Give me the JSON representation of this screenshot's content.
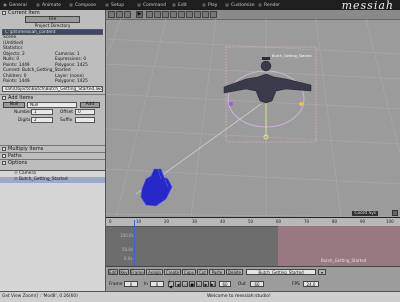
{
  "app": {
    "logo": "messiah"
  },
  "tabs": [
    {
      "label": "General"
    },
    {
      "label": "Animate"
    },
    {
      "label": "Compose"
    },
    {
      "label": "Setup"
    },
    {
      "label": "Command"
    },
    {
      "label": "Edit"
    },
    {
      "label": "Play"
    },
    {
      "label": "Customize"
    },
    {
      "label": "Render"
    }
  ],
  "left": {
    "current_item_header": "Current Item",
    "file_button": "File",
    "project_directory_label": "Project Directory",
    "project_directory_value": "C:\\pts\\messiah_content",
    "scene_label": "Scene",
    "scene_value": "(Untitled)",
    "statistics_label": "Statistics",
    "stats": [
      {
        "left": "Objects: 2",
        "right": "Cameras: 1"
      },
      {
        "left": "Nulls: 0",
        "right": "Expressions: 0"
      },
      {
        "left": "Points: 1449",
        "right": "Polygons: 1425"
      }
    ],
    "current_line": "Current: Butch_Getting_Started",
    "objects_line": "Children: 0",
    "layer_line": "Layer: (none)",
    "points_line2": "Points: 1449",
    "polygons_line2": "Polygons: 1425",
    "path_value": "sah\\Objects\\Butch\\Butch_Getting_Started.lwo",
    "add_items_label": "Add Items",
    "null_button": "Null",
    "null_field": "Null",
    "add_button": "Add",
    "number_label": "Number",
    "number_value": "1",
    "offset_label": "Offset",
    "offset_value": "0",
    "digits_label": "Digits",
    "digits_value": "2",
    "suffix_label": "Suffix",
    "multiply_items_label": "Multiply Items",
    "paths_label": "Paths",
    "options_label": "Options",
    "tree_items": [
      {
        "label": "Camera",
        "selected": false
      },
      {
        "label": "Butch_Getting_Started",
        "selected": true
      }
    ]
  },
  "viewport": {
    "coord_label": "Coord Sys",
    "item_label": "Butch_Getting_Started"
  },
  "timeline": {
    "ticks": [
      "0",
      "10",
      "20",
      "30",
      "40",
      "50",
      "60",
      "70",
      "80",
      "90",
      "100"
    ],
    "tracks": [
      "100.0s",
      "50.0s",
      "0.0s"
    ],
    "zone_label": "Butch_Getting_Started"
  },
  "playbar": {
    "row1": [
      {
        "label": "Edit"
      },
      {
        "label": "Key"
      },
      {
        "label": "Frame"
      },
      {
        "label": "Assign"
      },
      {
        "label": "Create"
      },
      {
        "label": "Copy"
      },
      {
        "label": "Cut"
      },
      {
        "label": "Paste"
      },
      {
        "label": "Delete"
      }
    ],
    "item_field": "Butch_Getting_Started",
    "frame_label": "Frame",
    "frame_value": "0",
    "in_label": "In",
    "in_value": "0",
    "out_label": "Out",
    "out_value": "60",
    "fps_label": "FPS",
    "fps_value": "24.0",
    "end_value": "60"
  },
  "status": {
    "left": "Get View Zoom() : 'Mod8', 0.26(60)",
    "message": "Welcome to messiah:studio!"
  }
}
